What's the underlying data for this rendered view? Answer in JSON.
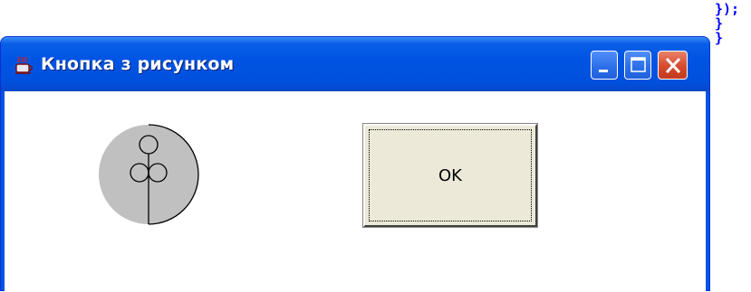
{
  "background_code": {
    "lines": [
      "});",
      "}",
      "}"
    ],
    "color": "#0000ff"
  },
  "window": {
    "title": "Кнопка з рисунком",
    "icon": "java-cup-icon",
    "titlebar_color": "#0054e3",
    "buttons": {
      "minimize": "minimize-icon",
      "maximize": "maximize-icon",
      "close": "close-icon"
    }
  },
  "content": {
    "image_icon": "clover-circle-icon",
    "ok_button": {
      "label": "OK",
      "face_color": "#ece9d8"
    }
  }
}
